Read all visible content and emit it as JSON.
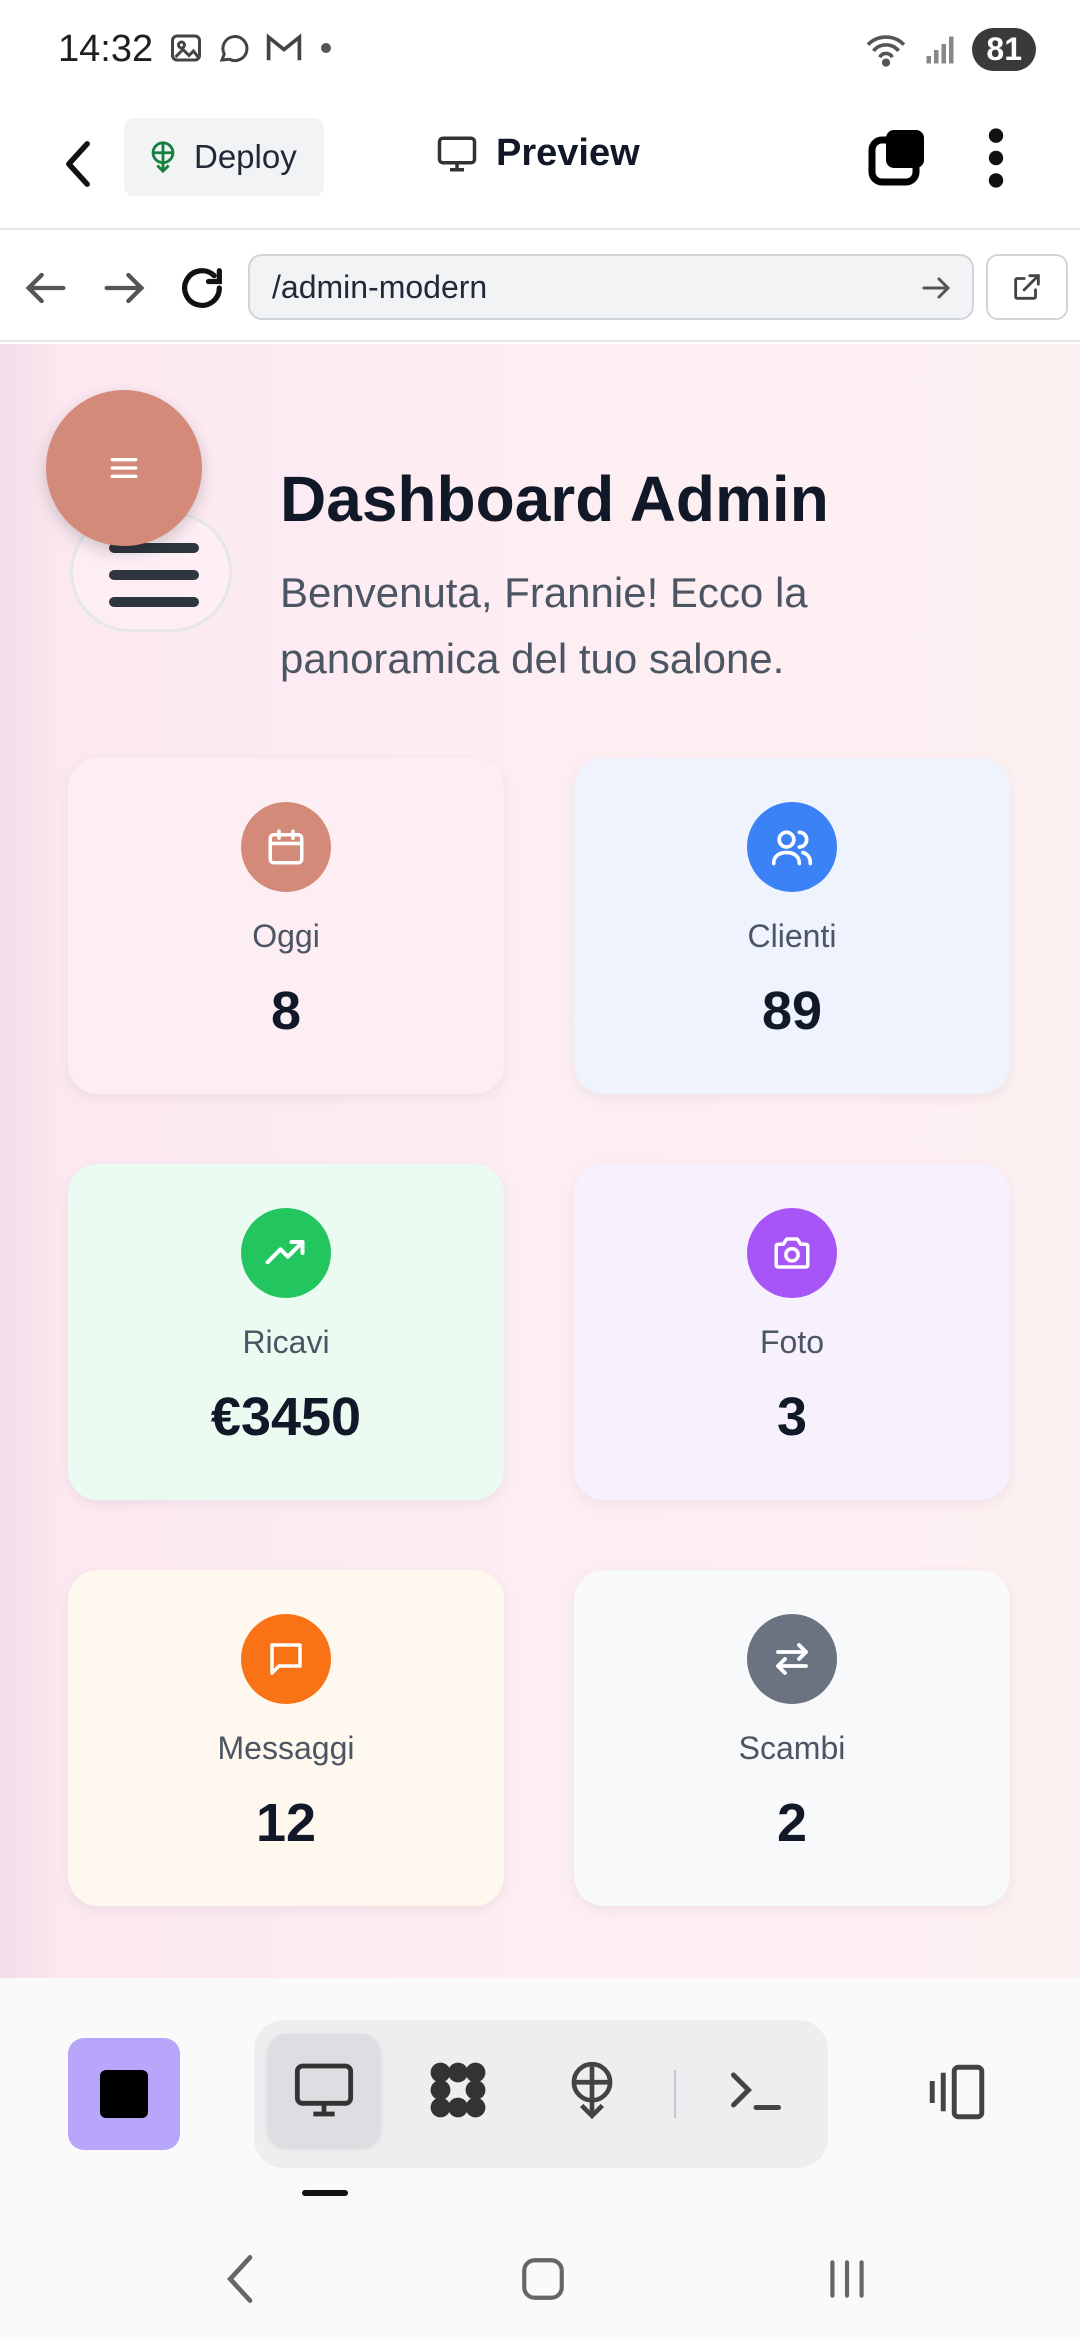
{
  "status_bar": {
    "time": "14:32",
    "left_icons": [
      "gallery-icon",
      "whatsapp-icon",
      "gmail-icon",
      "dot-icon"
    ],
    "right_icons": [
      "wifi-icon",
      "signal-icon"
    ],
    "battery": "81"
  },
  "header": {
    "deploy_label": "Deploy",
    "preview_label": "Preview"
  },
  "browser": {
    "url": "/admin-modern"
  },
  "dashboard": {
    "title": "Dashboard Admin",
    "subtitle": "Benvenuta, Frannie! Ecco la panoramica del tuo salone.",
    "stats": [
      {
        "label": "Oggi",
        "value": "8",
        "icon": "calendar-icon",
        "icon_color": "#d48a78",
        "card_color": "#fdeef4"
      },
      {
        "label": "Clienti",
        "value": "89",
        "icon": "users-icon",
        "icon_color": "#3b82f6",
        "card_color": "#eef3fe"
      },
      {
        "label": "Ricavi",
        "value": "€3450",
        "icon": "trending-up-icon",
        "icon_color": "#22c55e",
        "card_color": "#ecfbf2"
      },
      {
        "label": "Foto",
        "value": "3",
        "icon": "camera-icon",
        "icon_color": "#a855f7",
        "card_color": "#f7f1fd"
      },
      {
        "label": "Messaggi",
        "value": "12",
        "icon": "message-icon",
        "icon_color": "#f97316",
        "card_color": "#fef8ee"
      },
      {
        "label": "Scambi",
        "value": "2",
        "icon": "swap-icon",
        "icon_color": "#6b7280",
        "card_color": "#f8f9fb"
      }
    ]
  },
  "toolbar": {
    "tools": [
      "monitor-icon",
      "flower-icon",
      "deploy-icon",
      "terminal-icon"
    ],
    "active_tool": "monitor-icon"
  }
}
